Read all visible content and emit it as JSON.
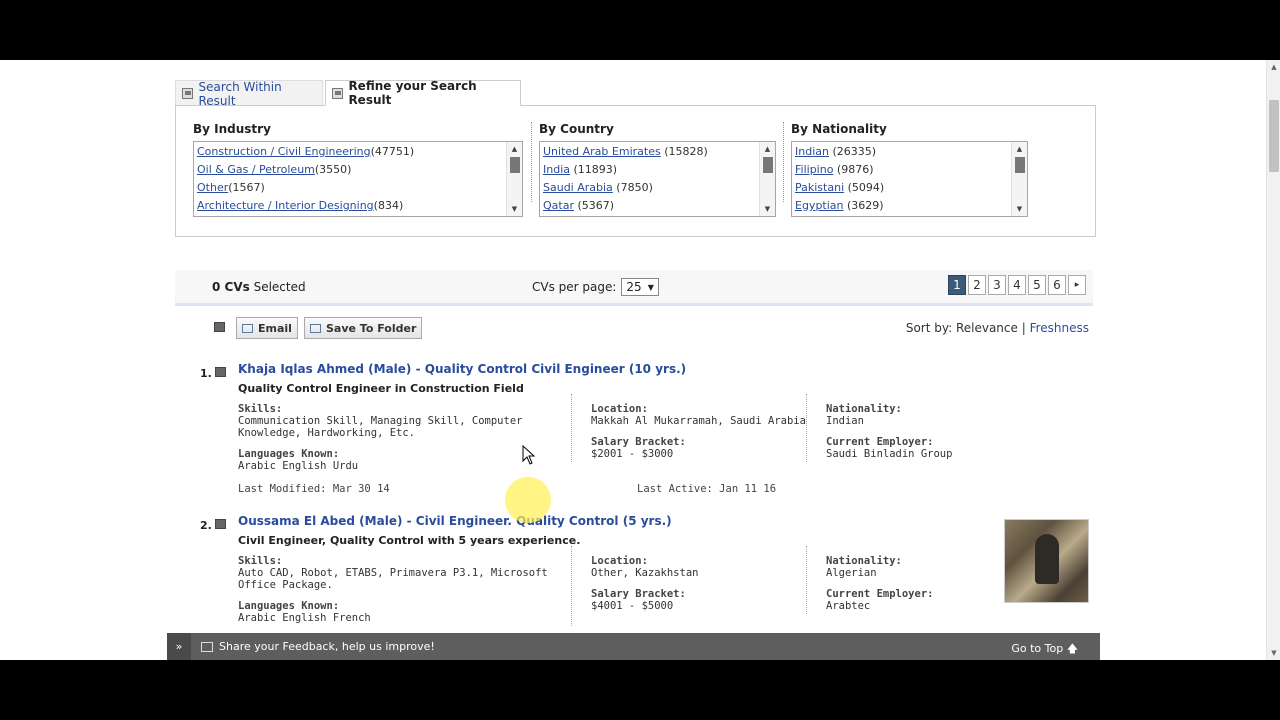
{
  "tabs": {
    "search_within": "Search Within Result",
    "refine": "Refine your Search Result"
  },
  "facets": {
    "industry": {
      "title": "By Industry",
      "items": [
        {
          "name": "Construction / Civil Engineering",
          "count": "(47751)"
        },
        {
          "name": "Oil & Gas / Petroleum",
          "count": "(3550)"
        },
        {
          "name": "Other",
          "count": "(1567)"
        },
        {
          "name": "Architecture / Interior Designing",
          "count": "(834)"
        }
      ]
    },
    "country": {
      "title": "By Country",
      "items": [
        {
          "name": "United Arab Emirates",
          "count": " (15828)"
        },
        {
          "name": "India",
          "count": " (11893)"
        },
        {
          "name": "Saudi Arabia",
          "count": " (7850)"
        },
        {
          "name": "Qatar",
          "count": " (5367)"
        }
      ]
    },
    "nationality": {
      "title": "By Nationality",
      "items": [
        {
          "name": "Indian",
          "count": " (26335)"
        },
        {
          "name": "Filipino",
          "count": " (9876)"
        },
        {
          "name": "Pakistani",
          "count": " (5094)"
        },
        {
          "name": "Egyptian",
          "count": " (3629)"
        }
      ]
    }
  },
  "controls": {
    "selected_count": "0 CVs",
    "selected_label": " Selected",
    "per_page_label": "CVs per page:",
    "per_page_value": "25",
    "pages": [
      "1",
      "2",
      "3",
      "4",
      "5",
      "6"
    ],
    "next": "▸"
  },
  "actions": {
    "email": "Email",
    "save_folder": "Save To Folder",
    "sort_label": "Sort by: Relevance",
    "sort_sep": " | ",
    "sort_alt": "Freshness"
  },
  "results": [
    {
      "num": "1.",
      "title": "Khaja Iqlas Ahmed (Male) - Quality Control Civil Engineer (10 yrs.)",
      "subtitle": "Quality Control Engineer in Construction Field",
      "skills_label": "Skills:",
      "skills": "Communication Skill, Managing Skill, Computer Knowledge, Hardworking, Etc.",
      "languages_label": "Languages Known:",
      "languages": "Arabic English Urdu",
      "location_label": "Location:",
      "location": "Makkah Al Mukarramah, Saudi Arabia",
      "salary_label": "Salary Bracket:",
      "salary": "$2001 - $3000",
      "nationality_label": "Nationality:",
      "nationality": "Indian",
      "employer_label": "Current Employer:",
      "employer": "Saudi Binladin Group",
      "last_modified": "Last Modified: Mar 30 14",
      "last_active": "Last Active: Jan 11 16"
    },
    {
      "num": "2.",
      "title": "Oussama El Abed (Male) - Civil Engineer. Quality Control (5 yrs.)",
      "subtitle": "Civil Engineer, Quality Control with 5 years experience.",
      "skills_label": "Skills:",
      "skills": "Auto CAD, Robot, ETABS, Primavera P3.1, Microsoft Office Package.",
      "languages_label": "Languages Known:",
      "languages": "Arabic English French",
      "location_label": "Location:",
      "location": "Other, Kazakhstan",
      "salary_label": "Salary Bracket:",
      "salary": "$4001 - $5000",
      "nationality_label": "Nationality:",
      "nationality": "Algerian",
      "employer_label": "Current Employer:",
      "employer": "Arabtec"
    }
  ],
  "feedback": {
    "toggle": "»",
    "text": "Share your Feedback, help us improve!",
    "top": "Go to Top",
    "top_arrow": "🡅"
  }
}
